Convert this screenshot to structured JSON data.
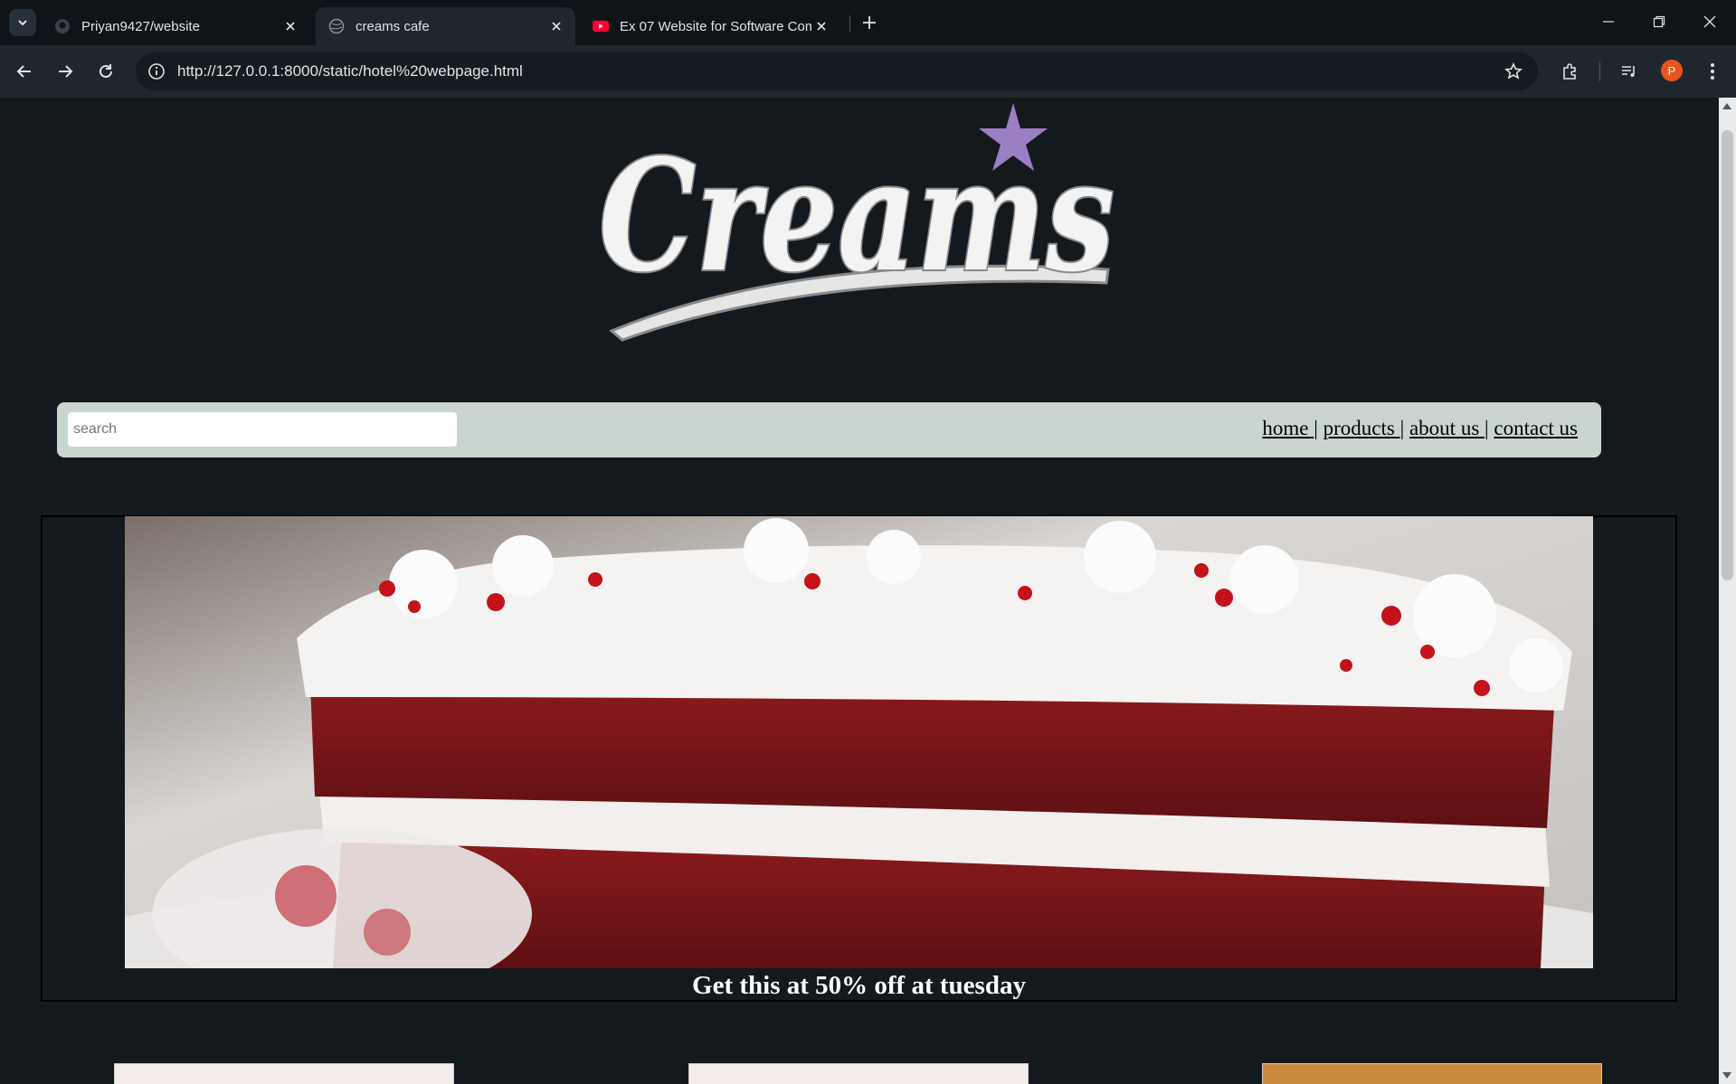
{
  "browser": {
    "tabs": [
      {
        "title": "Priyan9427/website",
        "favicon": "github-icon",
        "active": false
      },
      {
        "title": "creams cafe",
        "favicon": "globe-icon",
        "active": true
      },
      {
        "title": "Ex 07 Website for Software Com",
        "favicon": "youtube-icon",
        "active": false
      }
    ],
    "url": "http://127.0.0.1:8000/static/hotel%20webpage.html",
    "avatar_letter": "P",
    "accent": "#e8541e"
  },
  "page": {
    "logo_text": "Creams",
    "logo_star_color": "#9b7fc4",
    "search_placeholder": "search",
    "nav": {
      "home": "home ",
      "products": "products ",
      "about": "about us ",
      "contact": "contact us",
      "separator": "|"
    },
    "navbar_color": "#c9d6d0",
    "promo_caption": "Get this at 50% off at tuesday",
    "promo_image": "red-velvet-cake-photo"
  }
}
